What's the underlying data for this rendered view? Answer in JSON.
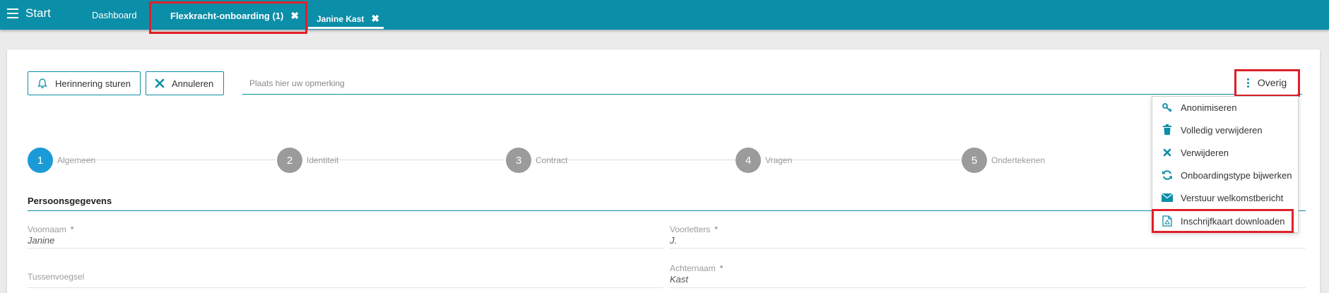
{
  "topbar": {
    "start_label": "Start",
    "tabs": [
      {
        "label": "Dashboard"
      },
      {
        "label": "Flexkracht-onboarding (1)",
        "close": "✖"
      },
      {
        "label": "Janine Kast",
        "close": "✖"
      }
    ]
  },
  "toolbar": {
    "remind_label": "Herinnering sturen",
    "cancel_label": "Annuleren",
    "remark_placeholder": "Plaats hier uw opmerking",
    "more_label": "Overig"
  },
  "menu": {
    "items": [
      {
        "label": "Anonimiseren",
        "icon": "key-icon"
      },
      {
        "label": "Volledig verwijderen",
        "icon": "trash-icon"
      },
      {
        "label": "Verwijderen",
        "icon": "close-icon"
      },
      {
        "label": "Onboardingstype bijwerken",
        "icon": "refresh-icon"
      },
      {
        "label": "Verstuur welkomstbericht",
        "icon": "envelope-icon"
      },
      {
        "label": "Inschrijfkaart downloaden",
        "icon": "pdf-file-icon"
      }
    ]
  },
  "steps": [
    {
      "number": "1",
      "label": "Algemeen",
      "active": true
    },
    {
      "number": "2",
      "label": "Identiteit",
      "active": false
    },
    {
      "number": "3",
      "label": "Contract",
      "active": false
    },
    {
      "number": "4",
      "label": "Vragen",
      "active": false
    },
    {
      "number": "5",
      "label": "Ondertekenen",
      "active": false
    }
  ],
  "section": {
    "title": "Persoonsgegevens",
    "fields": {
      "voornaam": {
        "label": "Voornaam",
        "required": "*",
        "value": "Janine"
      },
      "voorletters": {
        "label": "Voorletters",
        "required": "*",
        "value": "J."
      },
      "tussenvoegsel": {
        "label": "Tussenvoegsel"
      },
      "achternaam": {
        "label": "Achternaam",
        "required": "*",
        "value": "Kast"
      }
    }
  },
  "colors": {
    "accent": "#0b8ea8",
    "active_step": "#1a9bd7",
    "inactive_step": "#9b9b9b",
    "highlight": "#e0202a"
  }
}
